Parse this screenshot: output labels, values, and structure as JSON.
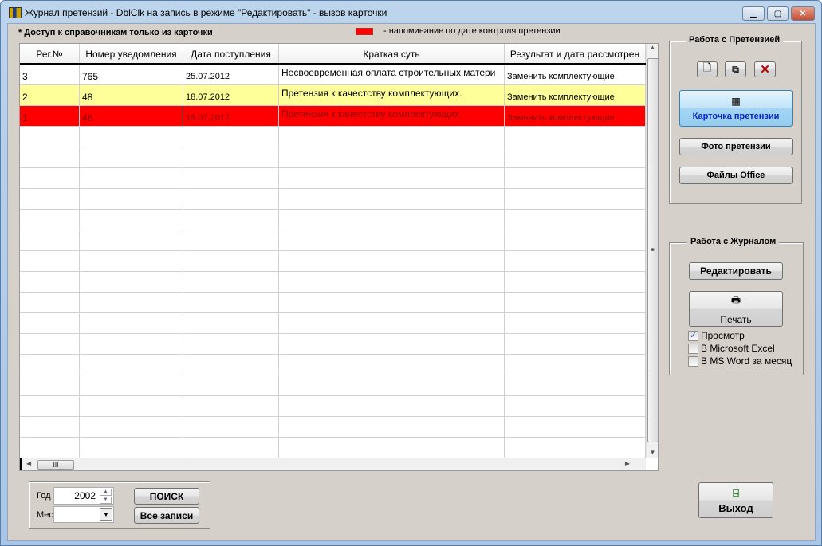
{
  "window": {
    "title": "Журнал претензий - DblClk на запись в режиме \"Редактировать\" - вызов карточки"
  },
  "note": "* Доступ к справочникам только из карточки",
  "legend": {
    "color": "#ff0000",
    "text": "- напоминание по дате контроля претензии"
  },
  "table": {
    "columns": [
      "Рег.№",
      "Номер уведомления",
      "Дата поступления",
      "Краткая суть",
      "Результат и дата рассмотрен"
    ],
    "rows": [
      {
        "reg": "3",
        "num": "765",
        "date": "25.07.2012",
        "summary": "Несвоевременная оплата строительных матери",
        "result": "Заменить комплектующие",
        "highlight": "none"
      },
      {
        "reg": "2",
        "num": "48",
        "date": "18.07.2012",
        "summary": "Претензия к качестству комплектующих.",
        "result": "Заменить комплектующие",
        "highlight": "yellow"
      },
      {
        "reg": "1",
        "num": "46",
        "date": "19.07.2012",
        "summary": "Претензия к качестству комплектующих.",
        "result": "Заменить комплектующие",
        "highlight": "red"
      }
    ]
  },
  "claim_group": {
    "title": "Работа с Претензией",
    "new_icon": "new-document-icon",
    "copy_icon": "copy-icon",
    "delete_icon": "delete-icon",
    "card_label": "Карточка претензии",
    "photo_label": "Фото претензии",
    "files_label": "Файлы Office"
  },
  "journal_group": {
    "title": "Работа с Журналом",
    "edit_label": "Редактировать",
    "print_label": "Печать",
    "checkboxes": [
      {
        "label": "Просмотр",
        "checked": true
      },
      {
        "label": "В Microsoft Excel",
        "checked": false
      },
      {
        "label": "В MS Word за месяц",
        "checked": false
      }
    ]
  },
  "filter": {
    "year_label": "Год",
    "year_value": "2002",
    "month_label": "Мес",
    "month_value": "",
    "search_label": "ПОИСК",
    "all_label": "Все записи"
  },
  "exit_label": "Выход"
}
